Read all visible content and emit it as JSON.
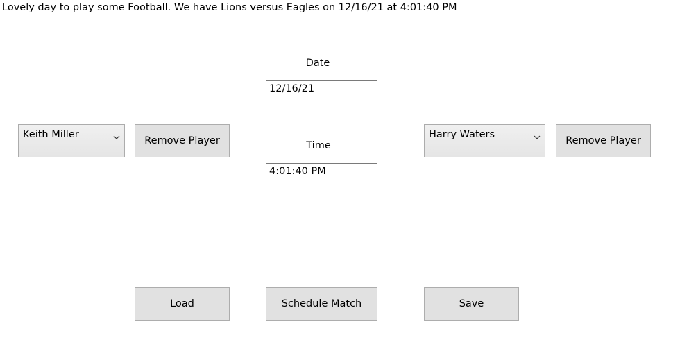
{
  "headline": "Lovely day to play some Football. We have Lions versus Eagles on 12/16/21 at 4:01:40 PM",
  "date": {
    "label": "Date",
    "value": "12/16/21"
  },
  "time": {
    "label": "Time",
    "value": "4:01:40 PM"
  },
  "left_team": {
    "selected_player": "Keith Miller",
    "remove_label": "Remove Player"
  },
  "right_team": {
    "selected_player": "Harry Waters",
    "remove_label": "Remove Player"
  },
  "actions": {
    "load_label": "Load",
    "schedule_label": "Schedule Match",
    "save_label": "Save"
  },
  "icons": {
    "combo_arrow": "chevron-down-icon"
  }
}
